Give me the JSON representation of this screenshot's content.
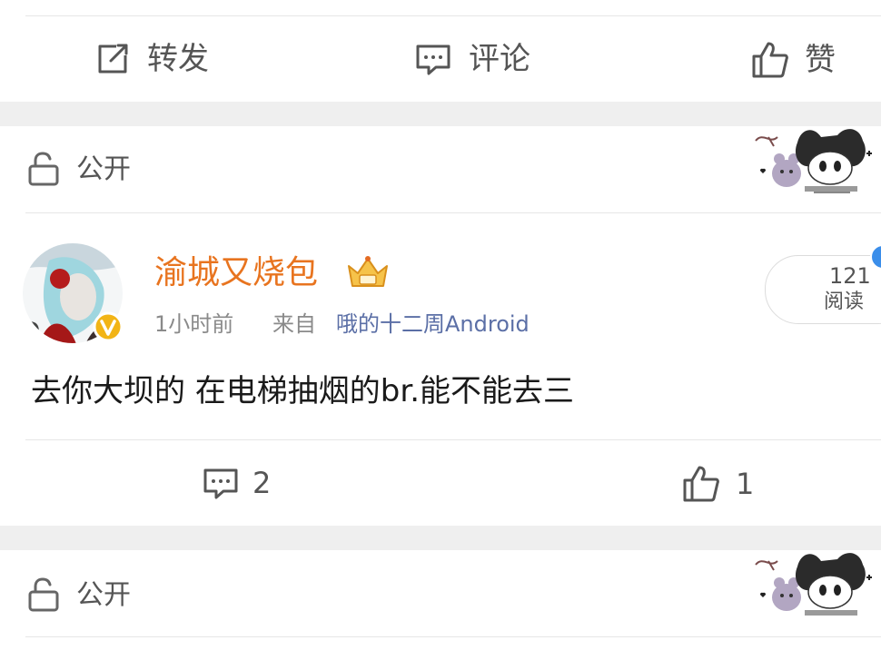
{
  "top_actions": {
    "repost_label": "转发",
    "comment_label": "评论",
    "like_label": "赞"
  },
  "privacy": {
    "label": "公开"
  },
  "post": {
    "username": "渝城又烧包",
    "time": "1小时前",
    "source_prefix": "来自",
    "source": "哦的十二周Android",
    "views_count": "121",
    "views_label": "阅读",
    "content": "去你大坝的 在电梯抽烟的br.能不能去三",
    "comments_count": "2",
    "likes_count": "1"
  },
  "privacy_2": {
    "label": "公开"
  },
  "colors": {
    "username": "#e8741f",
    "source_link": "#5b6fa6",
    "verified_badge": "#f2b416",
    "notification_dot": "#3b8eea"
  }
}
